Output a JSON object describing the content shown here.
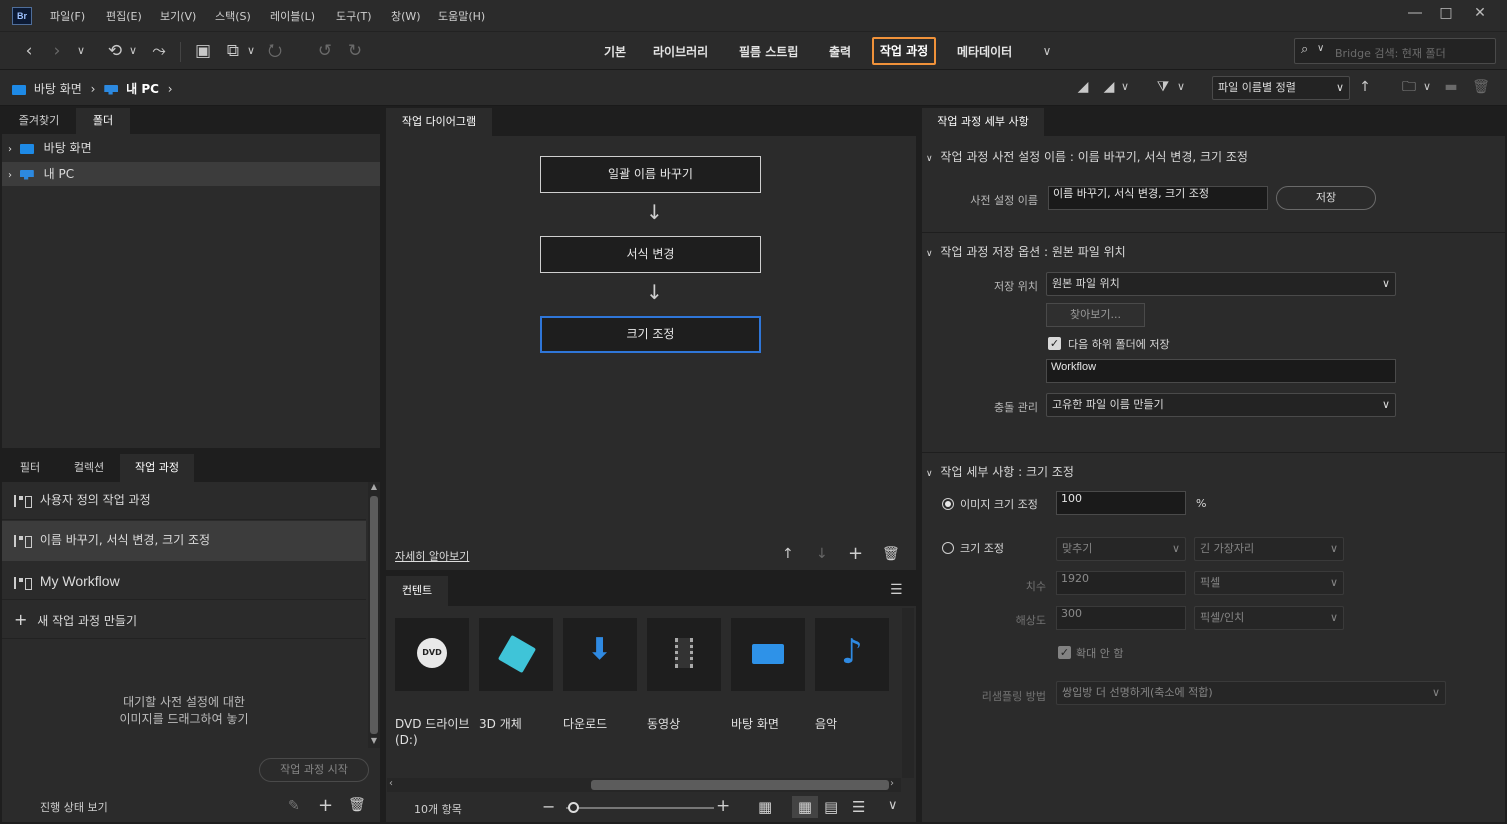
{
  "app": {
    "logo": "Br"
  },
  "menu": [
    "파일(F)",
    "편집(E)",
    "보기(V)",
    "스택(S)",
    "레이블(L)",
    "도구(T)",
    "창(W)",
    "도움말(H)"
  ],
  "workspaces": [
    "기본",
    "라이브러리",
    "필름 스트립",
    "출력",
    "작업 과정",
    "메타데이터"
  ],
  "search": {
    "placeholder": "Bridge 검색: 현재 폴더"
  },
  "breadcrumb": [
    "바탕 화면",
    "내 PC"
  ],
  "sort": {
    "label": "파일 이름별 정렬"
  },
  "left_panel": {
    "tabs": [
      "즐겨찾기",
      "폴더"
    ],
    "tree": [
      "바탕 화면",
      "내 PC"
    ]
  },
  "workflow_panel": {
    "tabs": [
      "필터",
      "컬렉션",
      "작업 과정"
    ],
    "items": [
      "사용자 정의 작업 과정",
      "이름 바꾸기, 서식 변경, 크기 조정",
      "My Workflow"
    ],
    "new_label": "새 작업 과정 만들기",
    "drop_hint_1": "대기할 사전 설정에 대한",
    "drop_hint_2": "이미지를 드래그하여 놓기",
    "start_label": "작업 과정 시작",
    "progress_label": "진행 상태 보기"
  },
  "diagram": {
    "tab": "작업 다이어그램",
    "steps": [
      "일괄 이름 바꾸기",
      "서식 변경",
      "크기 조정"
    ],
    "learn_more": "자세히 알아보기"
  },
  "content": {
    "tab": "컨텐트",
    "tiles": [
      "DVD 드라이브 (D:)",
      "3D 개체",
      "다운로드",
      "동영상",
      "바탕 화면",
      "음악"
    ],
    "count": "10개 항목"
  },
  "details": {
    "tab": "작업 과정 세부 사항",
    "preset_section": "작업 과정 사전 설정 이름 : 이름 바꾸기, 서식 변경, 크기 조정",
    "preset_label": "사전 설정 이름",
    "preset_value": "이름 바꾸기, 서식 변경, 크기 조정",
    "save_button": "저장",
    "save_section": "작업 과정 저장 옵션 : 원본 파일 위치",
    "location_label": "저장 위치",
    "location_value": "원본 파일 위치",
    "browse_button": "찾아보기...",
    "subfolder_label": "다음 하위 폴더에 저장",
    "subfolder_value": "Workflow",
    "conflict_label": "충돌 관리",
    "conflict_value": "고유한 파일 이름 만들기",
    "task_section": "작업 세부 사항 : 크기 조정",
    "image_size_label": "이미지 크기 조정",
    "image_size_value": "100",
    "percent": "%",
    "size_label": "크기 조정",
    "fit_value": "맞추기",
    "edge_value": "긴 가장자리",
    "dim_label": "치수",
    "dim_value": "1920",
    "dim_unit": "픽셀",
    "res_label": "해상도",
    "res_value": "300",
    "res_unit": "픽셀/인치",
    "no_enlarge": "확대 안 함",
    "resample_label": "리샘플링 방법",
    "resample_value": "쌍입방 더 선명하게(축소에 적합)"
  }
}
